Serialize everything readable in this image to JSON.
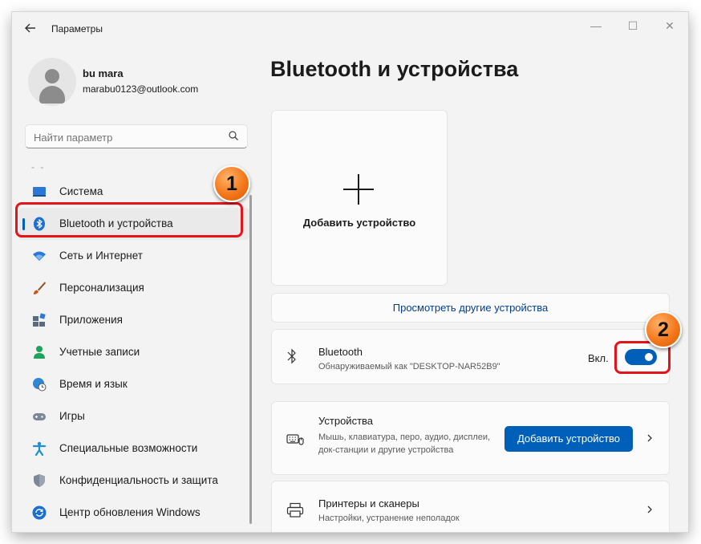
{
  "window": {
    "app_title": "Параметры",
    "back_icon": "arrow-left-icon",
    "controls": {
      "minimize": "—",
      "maximize": "☐",
      "close": "✕"
    }
  },
  "profile": {
    "name": "bu mara",
    "email": "marabu0123@outlook.com"
  },
  "search": {
    "placeholder": "Найти параметр"
  },
  "nav": {
    "overflow": "- -",
    "items": [
      {
        "label": "Система",
        "icon": "monitor-icon",
        "color": "#2b79d6"
      },
      {
        "label": "Bluetooth и устройства",
        "icon": "bluetooth-icon",
        "color": "#1a6fd1",
        "active": true
      },
      {
        "label": "Сеть и Интернет",
        "icon": "wifi-icon",
        "color": "#2b79d6"
      },
      {
        "label": "Персонализация",
        "icon": "paintbrush-icon",
        "color": "#c4561c"
      },
      {
        "label": "Приложения",
        "icon": "apps-icon",
        "color": "#5a6a80"
      },
      {
        "label": "Учетные записи",
        "icon": "person-icon",
        "color": "#1ea35a"
      },
      {
        "label": "Время и язык",
        "icon": "globe-clock-icon",
        "color": "#2e86d6"
      },
      {
        "label": "Игры",
        "icon": "gamepad-icon",
        "color": "#7c8897"
      },
      {
        "label": "Специальные возможности",
        "icon": "accessibility-icon",
        "color": "#1e8fd6"
      },
      {
        "label": "Конфиденциальность и защита",
        "icon": "shield-icon",
        "color": "#7b8796"
      },
      {
        "label": "Центр обновления Windows",
        "icon": "sync-icon",
        "color": "#1a6fd1"
      }
    ]
  },
  "main": {
    "title": "Bluetooth и устройства",
    "add_tile": {
      "label": "Добавить устройство"
    },
    "view_more": "Просмотреть другие устройства",
    "bluetooth": {
      "title": "Bluetooth",
      "subtitle": "Обнаруживаемый как \"DESKTOP-NAR52B9\"",
      "state": "Вкл.",
      "on": true
    },
    "devices": {
      "title": "Устройства",
      "description": "Мышь, клавиатура, перо, аудио, дисплеи, док-станции и другие устройства",
      "button": "Добавить устройство"
    },
    "printers": {
      "title": "Принтеры и сканеры",
      "subtitle": "Настройки, устранение неполадок"
    }
  },
  "annotations": {
    "step1": "1",
    "step2": "2",
    "color": "#e4141b"
  }
}
